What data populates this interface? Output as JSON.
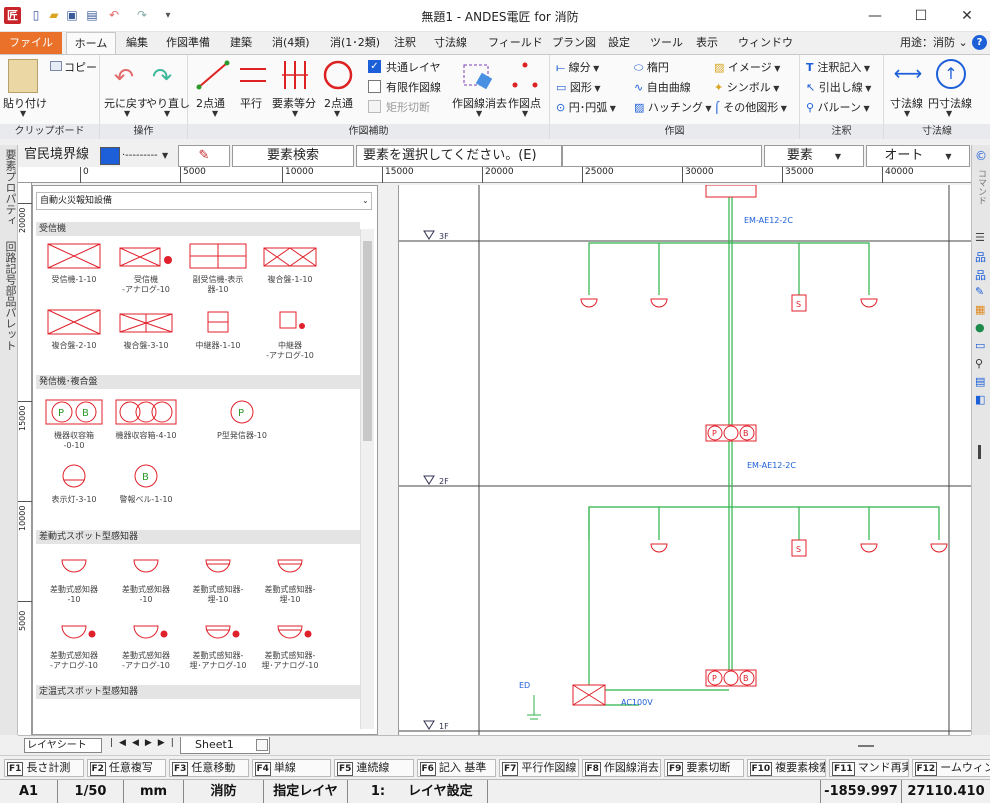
{
  "window": {
    "title": "無題1 - ANDES電匠 for 消防",
    "app_icon": "匠",
    "minimize": "—",
    "maximize": "☐",
    "close": "✕"
  },
  "menu": {
    "file": "ファイル",
    "home": "ホーム",
    "items": [
      "編集",
      "作図準備",
      "建築",
      "消(4類)",
      "消(1･2類)",
      "注釈",
      "寸法線",
      "フィールド",
      "プラン図",
      "設定",
      "ツール",
      "表示",
      "ウィンドウ"
    ],
    "usage": "用途：消防 ⌄"
  },
  "ribbon": {
    "clipboard": {
      "paste": "貼り付け",
      "copy": "コピー",
      "label": "クリップボード"
    },
    "operation": {
      "undo": "元に戻す",
      "redo": "やり直し",
      "label": "操作"
    },
    "drawaid": {
      "two_point": "2点通",
      "parallel": "平行",
      "equal_div": "要素等分",
      "two_point_circle": "2点通",
      "common_layer": "共通レイヤ",
      "limited_draw": "有限作図線",
      "rect_cut": "矩形切断",
      "erase_draw": "作図線消去",
      "draw_point": "作図点",
      "label": "作図補助"
    },
    "drawing": {
      "line": "線分",
      "ellipse": "楕円",
      "image": "イメージ",
      "shape": "図形",
      "free_curve": "自由曲線",
      "symbol": "シンボル",
      "circle_arc": "円･円弧",
      "hatching": "ハッチング",
      "other_shape": "その他図形",
      "label": "作図"
    },
    "annotation": {
      "note": "注釈記入",
      "leader": "引出し線",
      "balloon": "バルーン",
      "label": "注釈"
    },
    "dimension": {
      "dim_line": "寸法線",
      "circle_dim": "円寸法線",
      "label": "寸法線"
    }
  },
  "toolrow": {
    "linetype": "官民境界線",
    "dashes": "·---------",
    "search": "要素検索",
    "prompt": "要素を選択してください。(E)",
    "element": "要素",
    "auto": "オート"
  },
  "left_tabs": [
    "要素プロパティ",
    "回路記号部品パレット"
  ],
  "ruler": {
    "h_ticks": [
      "0",
      "5000",
      "10000",
      "15000",
      "20000",
      "25000",
      "30000",
      "35000",
      "40000"
    ],
    "v_ticks": [
      "20000",
      "15000",
      "10000",
      "5000"
    ]
  },
  "palette": {
    "selector": "自動火災報知設備",
    "categories": [
      "受信機",
      "発信機･複合盤",
      "差動式スポット型感知器",
      "定温式スポット型感知器"
    ],
    "receiver_symbols": [
      {
        "label": "受信機-1-10"
      },
      {
        "label": "受信機\n-アナログ-10"
      },
      {
        "label": "副受信機-表示\n器-10"
      },
      {
        "label": "複合盤-1-10"
      },
      {
        "label": "複合盤-2-10"
      },
      {
        "label": "複合盤-3-10"
      },
      {
        "label": "中継器-1-10"
      },
      {
        "label": "中継器\n-アナログ-10"
      }
    ],
    "transmitter_symbols": [
      {
        "label": "機器収容箱\n-0-10"
      },
      {
        "label": "機器収容箱-4-10"
      },
      {
        "label": "P型発信器-10"
      },
      {
        "label": "表示灯-3-10"
      },
      {
        "label": "警報ベル-1-10"
      }
    ],
    "sensor_symbols": [
      {
        "label": "差動式感知器\n-10"
      },
      {
        "label": "差動式感知器\n-10"
      },
      {
        "label": "差動式感知器-\n埋-10"
      },
      {
        "label": "差動式感知器-\n埋-10"
      },
      {
        "label": "差動式感知器\n-アナログ-10"
      },
      {
        "label": "差動式感知器\n-アナログ-10"
      },
      {
        "label": "差動式感知器-\n埋･アナログ-10"
      },
      {
        "label": "差動式感知器-\n埋･アナログ-10"
      }
    ]
  },
  "drawing": {
    "floors": [
      "3F",
      "2F",
      "1F"
    ],
    "cable_labels": [
      "EM-AE12-2C",
      "EM-AE12-2C"
    ],
    "bottom_labels": [
      "ED",
      "AC100V"
    ],
    "box_letters": [
      "P",
      "B"
    ],
    "sensor_marks": [
      "S",
      "s"
    ]
  },
  "sheetbar": {
    "tab_sheet": "レイヤシート",
    "sheet1": "Sheet1"
  },
  "fkeys": [
    {
      "key": "F1",
      "label": "長さ計測"
    },
    {
      "key": "F2",
      "label": "任意複写"
    },
    {
      "key": "F3",
      "label": "任意移動"
    },
    {
      "key": "F4",
      "label": "単線"
    },
    {
      "key": "F5",
      "label": "連続線"
    },
    {
      "key": "F6",
      "label": "記入 基準"
    },
    {
      "key": "F7",
      "label": "平行作図線"
    },
    {
      "key": "F8",
      "label": "作図線消去"
    },
    {
      "key": "F9",
      "label": "要素切断"
    },
    {
      "key": "F10",
      "label": "複要素検索"
    },
    {
      "key": "F11",
      "label": "マンド再実"
    },
    {
      "key": "F12",
      "label": "ームウィンド"
    }
  ],
  "status": {
    "sheet": "A1",
    "scale": "1/50",
    "unit": "mm",
    "category": "消防",
    "layer_mode": "指定レイヤ",
    "layer": "1:",
    "layer_setting": "レイヤ設定",
    "x": "-1859.997",
    "y": "27110.410"
  },
  "colors": {
    "file_orange": "#e9712a",
    "symbol_red": "#e0202a",
    "wire_green": "#2db34a",
    "accent_blue": "#1c5fd8"
  }
}
